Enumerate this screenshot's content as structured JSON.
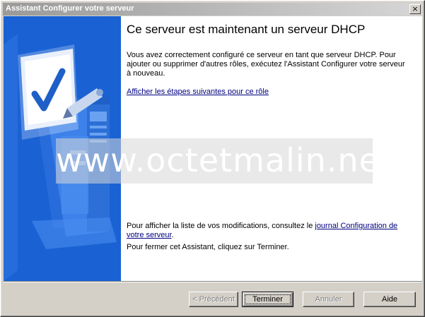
{
  "window": {
    "title": "Assistant Configurer votre serveur",
    "close_glyph": "×"
  },
  "main": {
    "heading": "Ce serveur est maintenant un serveur DHCP",
    "description": "Vous avez correctement configuré ce serveur en tant que serveur DHCP. Pour ajouter ou supprimer d'autres rôles, exécutez l'Assistant Configurer votre serveur à nouveau.",
    "next_steps_link": "Afficher les étapes suivantes pour ce rôle",
    "log_text_before": "Pour afficher la liste de vos modifications, consultez le ",
    "log_link": "journal Configuration de votre serveur",
    "log_text_after": ".",
    "close_text": "Pour fermer cet Assistant, cliquez sur Terminer."
  },
  "buttons": {
    "previous": "< Précédent",
    "finish": "Terminer",
    "cancel": "Annuler",
    "help": "Aide"
  },
  "watermark": "www.octetmalin.net",
  "icons": {
    "illustration": "server-checklist-illustration",
    "close": "close-icon"
  },
  "colors": {
    "title_gradient_start": "#9a9a9a",
    "title_gradient_end": "#d6d6d6",
    "sidebar": "#1a62d4",
    "link": "#000080"
  }
}
